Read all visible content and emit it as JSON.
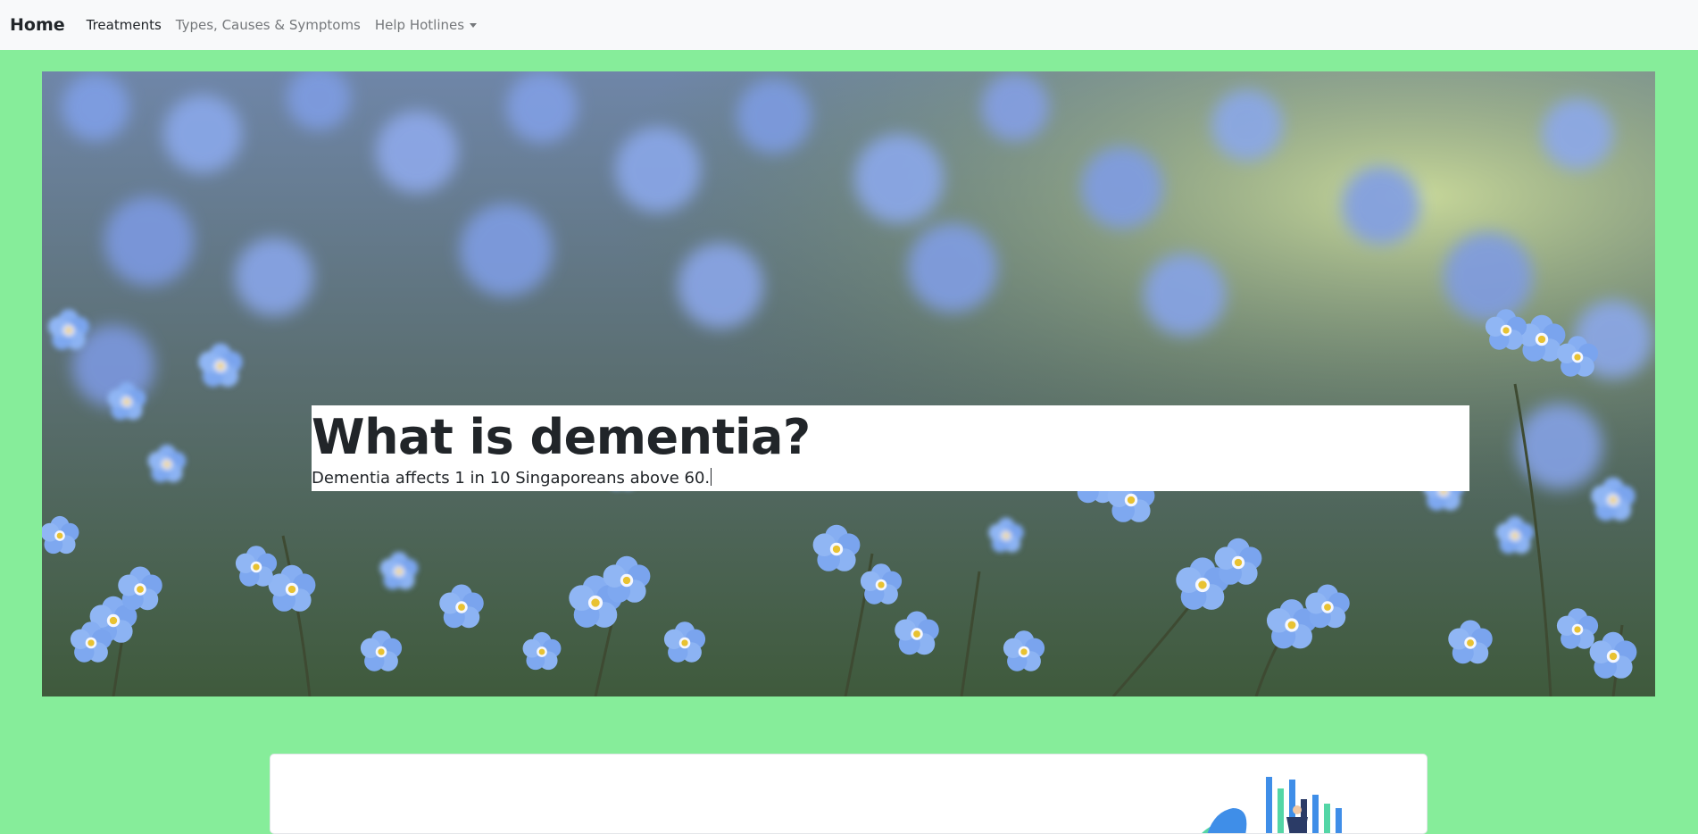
{
  "navbar": {
    "brand": "Home",
    "links": [
      {
        "label": "Treatments"
      },
      {
        "label": "Types, Causes & Symptoms"
      },
      {
        "label": "Help Hotlines"
      }
    ]
  },
  "hero": {
    "title": "What is dementia?",
    "subtitle": "Dementia affects 1 in 10 Singaporeans above 60."
  },
  "colors": {
    "page_background": "#86ed9a",
    "navbar_background": "#f8f9fa",
    "text_dark": "#212529",
    "nav_muted": "#75787b",
    "flower_blue": "#7da7ef"
  }
}
